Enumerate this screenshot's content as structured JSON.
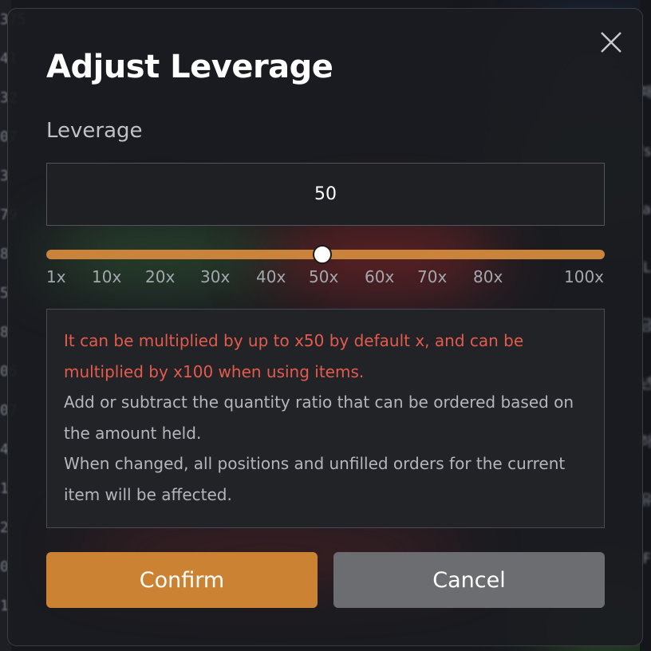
{
  "background": {
    "left_glyphs": [
      "375",
      "41",
      "32",
      "07",
      "3",
      "79",
      "8",
      "5",
      "8",
      "06",
      "07",
      "4",
      "1",
      "2",
      "0",
      "1"
    ],
    "right_glyphs": [
      "패",
      "'s",
      "",
      "a",
      "L",
      "금",
      "년",
      "하",
      "유",
      "F"
    ]
  },
  "dialog": {
    "title": "Adjust Leverage",
    "close_icon": "close-icon",
    "leverage_label": "Leverage",
    "leverage_value": "50",
    "slider": {
      "min": 1,
      "max": 100,
      "value": 50,
      "tick_labels": [
        "1x",
        "10x",
        "20x",
        "30x",
        "40x",
        "50x",
        "60x",
        "70x",
        "80x",
        "100x"
      ]
    },
    "info": {
      "warning_line_1": "It can be multiplied by up to x50 by default x, and can be",
      "warning_line_2": "multiplied by x100 when using items.",
      "text_line_1": "Add or subtract the quantity ratio that can be ordered based on",
      "text_line_2": "the amount held.",
      "text_line_3": "When changed, all positions and unfilled orders for the current",
      "text_line_4": "item will be affected."
    },
    "confirm_label": "Confirm",
    "cancel_label": "Cancel"
  },
  "colors": {
    "accent": "#cc8233",
    "warning": "#e45b4e",
    "cancel": "#6c6d70"
  }
}
